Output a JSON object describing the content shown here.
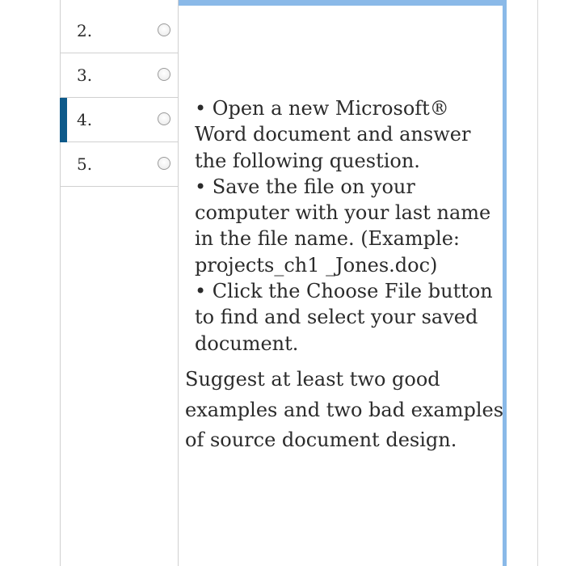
{
  "questions": [
    {
      "number": "2.",
      "active": false
    },
    {
      "number": "3.",
      "active": false
    },
    {
      "number": "4.",
      "active": true
    },
    {
      "number": "5.",
      "active": false
    }
  ],
  "instructions": [
    "• Open a new Microsoft® Word document and answer the following question.",
    "• Save the file on your computer with your last name in the file name. (Example: projects_ch1 _Jones.doc)",
    "• Click the Choose File button to find and select your saved document."
  ],
  "question_text": "Suggest at least two good examples and two bad examples of source document design.",
  "colors": {
    "active_marker": "#0e5a8a",
    "panel_border": "#8ab9e8"
  }
}
